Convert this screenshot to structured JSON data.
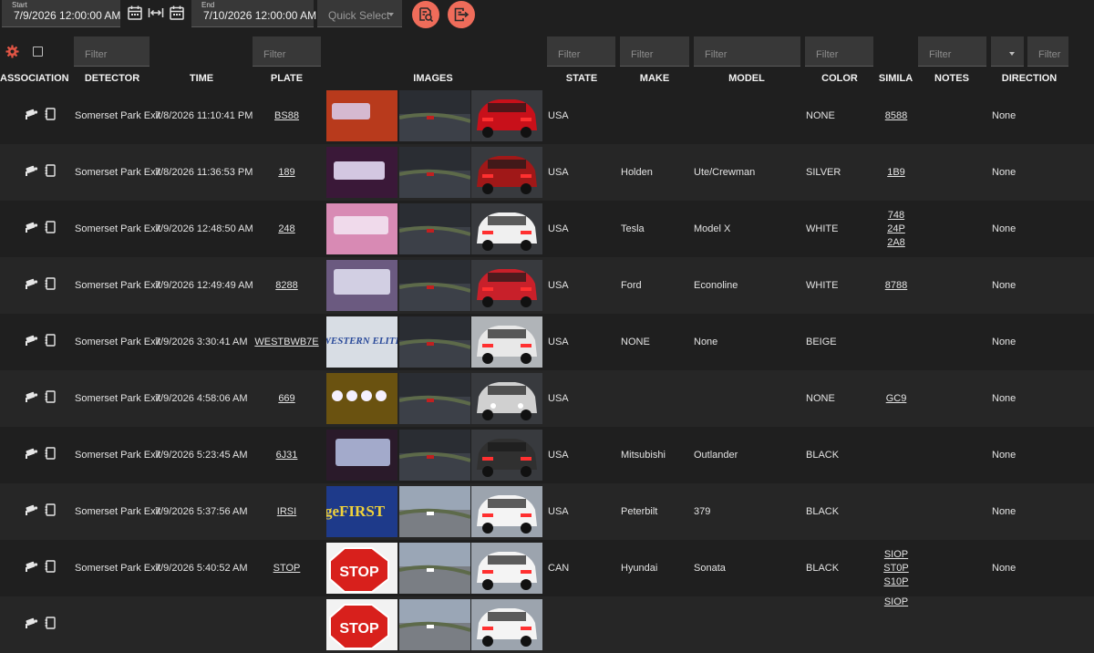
{
  "toolbar": {
    "start_label": "Start",
    "start_value": "7/9/2026 12:00:00 AM",
    "end_label": "End",
    "end_value": "7/10/2026 12:00:00 AM",
    "quick_select": "Quick Select",
    "icons": [
      "calendar-icon",
      "range-arrows-icon",
      "calendar-icon",
      "search-document-icon",
      "export-icon"
    ],
    "accent_color": "#ef6c5a"
  },
  "filters": {
    "placeholder": "Filter"
  },
  "columns": [
    "ASSOCIATIONS",
    "DETECTOR",
    "TIME",
    "PLATE",
    "IMAGES",
    "STATE",
    "MAKE",
    "MODEL",
    "COLOR",
    "SIMILA",
    "NOTES",
    "DIRECTION"
  ],
  "rows": [
    {
      "detector": "Somerset Park Exit",
      "time": "7/8/2026 11:10:41 PM",
      "plate": "BS88",
      "state": "USA",
      "make": "",
      "model": "",
      "color": "NONE",
      "similar": [
        "8588"
      ],
      "direction": "None"
    },
    {
      "detector": "Somerset Park Exit",
      "time": "7/8/2026 11:36:53 PM",
      "plate": "189",
      "state": "USA",
      "make": "Holden",
      "model": "Ute/Crewman",
      "color": "SILVER",
      "similar": [
        "1B9"
      ],
      "direction": "None"
    },
    {
      "detector": "Somerset Park Exit",
      "time": "7/9/2026 12:48:50 AM",
      "plate": "248",
      "state": "USA",
      "make": "Tesla",
      "model": "Model X",
      "color": "WHITE",
      "similar": [
        "748",
        "24P",
        "2A8"
      ],
      "direction": "None"
    },
    {
      "detector": "Somerset Park Exit",
      "time": "7/9/2026 12:49:49 AM",
      "plate": "8288",
      "state": "USA",
      "make": "Ford",
      "model": "Econoline",
      "color": "WHITE",
      "similar": [
        "8788"
      ],
      "direction": "None"
    },
    {
      "detector": "Somerset Park Exit",
      "time": "7/9/2026 3:30:41 AM",
      "plate": "WESTBWB7E",
      "state": "USA",
      "make": "NONE",
      "model": "None",
      "color": "BEIGE",
      "similar": [],
      "direction": "None"
    },
    {
      "detector": "Somerset Park Exit",
      "time": "7/9/2026 4:58:06 AM",
      "plate": "669",
      "state": "USA",
      "make": "",
      "model": "",
      "color": "NONE",
      "similar": [
        "GC9"
      ],
      "direction": "None"
    },
    {
      "detector": "Somerset Park Exit",
      "time": "7/9/2026 5:23:45 AM",
      "plate": "6J31",
      "state": "USA",
      "make": "Mitsubishi",
      "model": "Outlander",
      "color": "BLACK",
      "similar": [],
      "direction": "None"
    },
    {
      "detector": "Somerset Park Exit",
      "time": "7/9/2026 5:37:56 AM",
      "plate": "IRSI",
      "state": "USA",
      "make": "Peterbilt",
      "model": "379",
      "color": "BLACK",
      "similar": [],
      "direction": "None"
    },
    {
      "detector": "Somerset Park Exit",
      "time": "7/9/2026 5:40:52 AM",
      "plate": "STOP",
      "state": "CAN",
      "make": "Hyundai",
      "model": "Sonata",
      "color": "BLACK",
      "similar": [
        "SIOP",
        "ST0P",
        "S10P"
      ],
      "direction": "None"
    },
    {
      "detector": "",
      "time": "",
      "plate": "",
      "state": "",
      "make": "",
      "model": "",
      "color": "",
      "similar": [
        "SIOP"
      ],
      "direction": ""
    }
  ],
  "thumb_text": {
    "western": "WESTERN ELITE",
    "first": "geFIRST",
    "stop": "STOP"
  }
}
